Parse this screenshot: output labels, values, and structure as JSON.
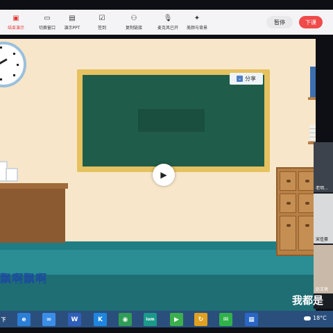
{
  "toolbar": {
    "items": [
      {
        "label": "结束演示",
        "icon": "screen-share-stop-icon",
        "active": true
      },
      {
        "label": "切换窗口",
        "icon": "switch-window-icon",
        "active": false
      },
      {
        "label": "演示PPT",
        "icon": "ppt-icon",
        "active": false
      },
      {
        "label": "签到",
        "icon": "check-in-icon",
        "active": false
      },
      {
        "label": "复制链接",
        "icon": "add-person-icon",
        "active": false
      },
      {
        "label": "麦克风已开",
        "icon": "microphone-icon",
        "active": false
      },
      {
        "label": "美颜与背景",
        "icon": "sparkle-icon",
        "active": false
      }
    ],
    "pause_label": "暂停",
    "end_label": "下课"
  },
  "video": {
    "share_label": "分享",
    "subtitle_left": "飘啊飘啊",
    "subtitle_right": "我都是",
    "play_icon": "play-icon"
  },
  "participants": [
    {
      "name": "老明…"
    },
    {
      "name": "宋佳豪"
    },
    {
      "name": "赵文贤"
    }
  ],
  "taskbar": {
    "start_label": "下",
    "apps": [
      {
        "icon": "edge-icon",
        "glyph": "e",
        "color": "#2b7fd6"
      },
      {
        "icon": "baidu-netdisk-icon",
        "glyph": "∞",
        "color": "#3b8ee8"
      },
      {
        "icon": "wps-icon",
        "glyph": "W",
        "color": "#2f5fb8"
      },
      {
        "icon": "kugou-icon",
        "glyph": "K",
        "color": "#1e86e0"
      },
      {
        "icon": "chrome-icon",
        "glyph": "◉",
        "color": "#2f9d55"
      },
      {
        "icon": "iom-icon",
        "glyph": "iom",
        "color": "#1b9a8a"
      },
      {
        "icon": "video-app-icon",
        "glyph": "▶",
        "color": "#3bb04c"
      },
      {
        "icon": "refresh-app-icon",
        "glyph": "↻",
        "color": "#e0a020"
      },
      {
        "icon": "wechat-icon",
        "glyph": "✉",
        "color": "#2fb24a"
      },
      {
        "icon": "grid-app-icon",
        "glyph": "▦",
        "color": "#2a66c4"
      }
    ],
    "weather": "18°C"
  }
}
